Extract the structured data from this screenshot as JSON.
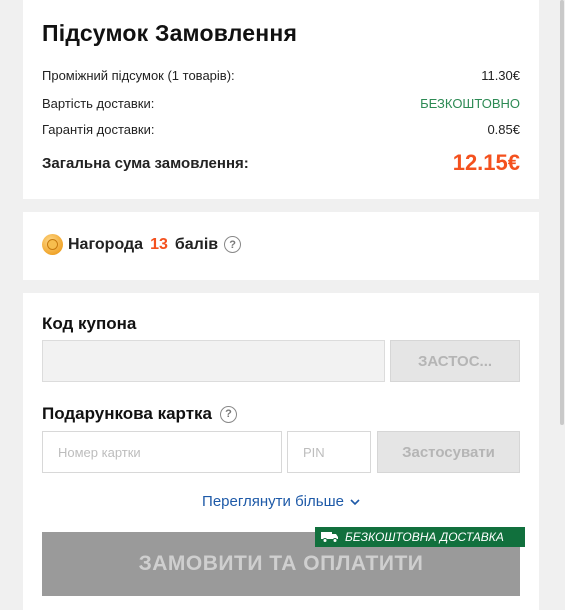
{
  "summary": {
    "title": "Підсумок Замовлення",
    "subtotal_label": "Проміжний підсумок (1 товарів):",
    "subtotal_value": "11.30€",
    "shipping_label": "Вартість доставки:",
    "shipping_value": "БЕЗКОШТОВНО",
    "guarantee_label": "Гарантія доставки:",
    "guarantee_value": "0.85€",
    "total_label": "Загальна сума замовлення:",
    "total_value": "12.15€"
  },
  "reward": {
    "prefix": "Нагорода",
    "points": "13",
    "suffix": "балів",
    "help_glyph": "?"
  },
  "coupon": {
    "label": "Код купона",
    "input_value": "",
    "apply_label": "ЗАСТОС..."
  },
  "gift_card": {
    "label": "Подарункова картка",
    "help_glyph": "?",
    "card_placeholder": "Номер картки",
    "pin_placeholder": "PIN",
    "apply_label": "Застосувати"
  },
  "more_link": "Переглянути більше",
  "checkout": {
    "button_label": "ЗАМОВИТИ ТА ОПЛАТИТИ",
    "badge_label": "БЕЗКОШТОВНА ДОСТАВКА"
  },
  "colors": {
    "accent_price": "#f4511e",
    "free_text": "#2d8a54",
    "badge_bg": "#11703d",
    "link": "#1e5aa8",
    "checkout_disabled": "#9a9a9a"
  },
  "icons": {
    "coin": "coin-icon",
    "help": "help-icon",
    "chevron": "chevron-down-icon",
    "truck": "truck-icon"
  }
}
